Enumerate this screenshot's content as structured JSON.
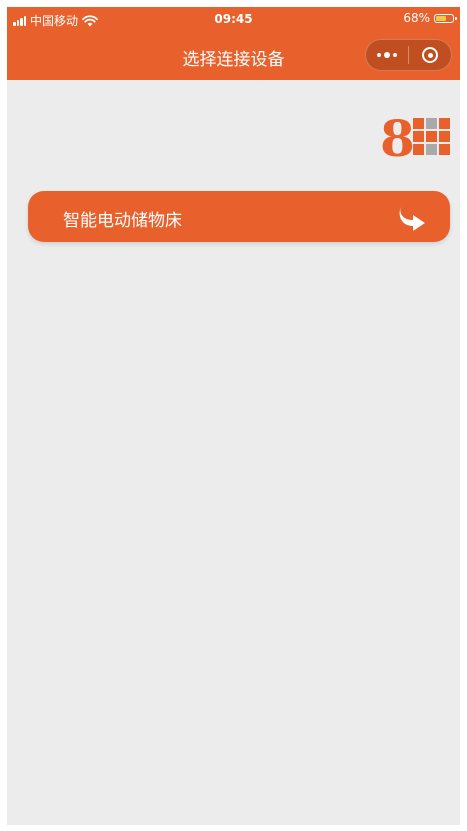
{
  "status_bar": {
    "carrier": "中国移动",
    "time": "09:45",
    "battery_percent_text": "68%",
    "battery_level": 0.68,
    "wifi_icon": "wifi-icon",
    "signal_icon": "signal-icon"
  },
  "nav": {
    "title": "选择连接设备",
    "more_icon": "more-dots-icon",
    "close_icon": "target-circle-icon"
  },
  "logo": {
    "text": "8H",
    "icon": "brand-logo-8h"
  },
  "devices": [
    {
      "label": "智能电动储物床",
      "icon": "connect-arrow-icon"
    }
  ],
  "colors": {
    "accent": "#e8602c",
    "background": "#ececec",
    "logo_grey": "#a9a9a9"
  }
}
